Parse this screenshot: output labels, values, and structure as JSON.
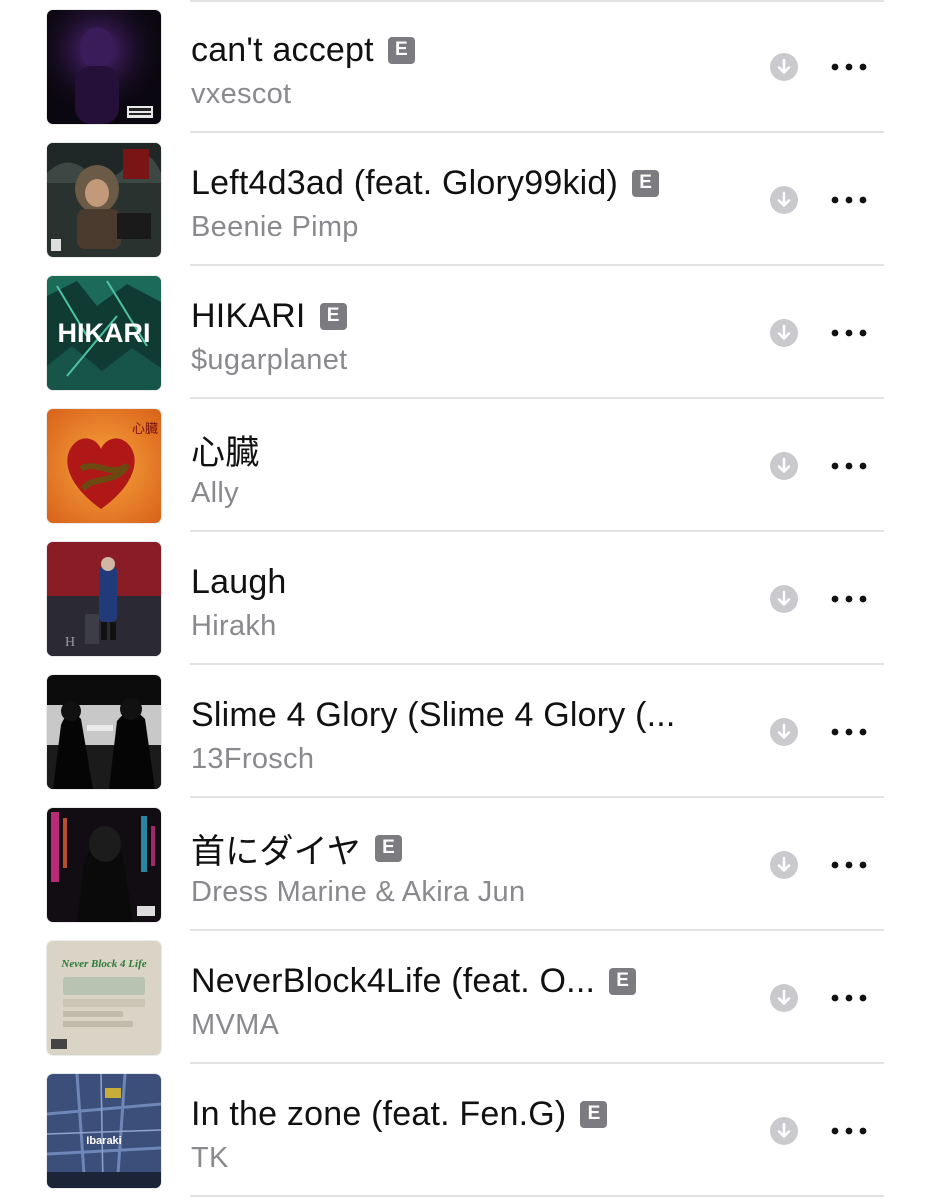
{
  "tracks": [
    {
      "title": "can't accept",
      "artist": "vxescot",
      "explicit": true,
      "explicit_label": "E",
      "artwork": "dark-purple-portrait-artwork"
    },
    {
      "title": "Left4d3ad (feat. Glory99kid)",
      "artist": "Beenie Pimp",
      "explicit": true,
      "explicit_label": "E",
      "artwork": "hooded-figure-artwork"
    },
    {
      "title": "HIKARI",
      "artist": "$ugarplanet",
      "explicit": true,
      "explicit_label": "E",
      "artwork": "hikari-text-artwork",
      "artwork_text": "HIKARI"
    },
    {
      "title": "心臓",
      "artist": "Ally",
      "explicit": false,
      "explicit_label": "",
      "artwork": "heart-snake-artwork",
      "artwork_text": "心臓"
    },
    {
      "title": "Laugh",
      "artist": "Hirakh",
      "explicit": false,
      "explicit_label": "",
      "artwork": "red-room-figure-artwork",
      "artwork_text": "H"
    },
    {
      "title": "Slime 4 Glory (Slime 4 Glory (...",
      "artist": "13Frosch",
      "explicit": false,
      "explicit_label": "",
      "artwork": "bw-two-figures-artwork"
    },
    {
      "title": "首にダイヤ",
      "artist": "Dress Marine & Akira Jun",
      "explicit": true,
      "explicit_label": "E",
      "artwork": "neon-street-artwork"
    },
    {
      "title": "NeverBlock4Life (feat. O...",
      "artist": "MVMA",
      "explicit": true,
      "explicit_label": "E",
      "artwork": "never-block-4-life-artwork",
      "artwork_text": "Never Block 4 Life"
    },
    {
      "title": "In the zone (feat. Fen.G)",
      "artist": "TK",
      "explicit": true,
      "explicit_label": "E",
      "artwork": "map-ibaraki-artwork",
      "artwork_text": "Ibaraki"
    }
  ],
  "colors": {
    "title": "#111111",
    "subtitle": "#8a8a8e",
    "badge": "#7b7b80",
    "icon": "#c9c9ce",
    "divider": "#e2e2e4"
  }
}
